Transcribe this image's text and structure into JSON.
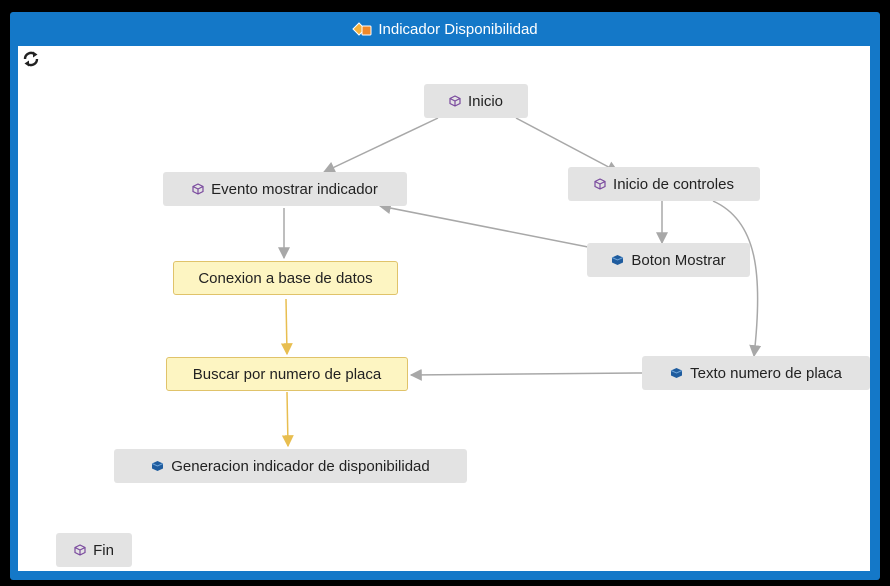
{
  "window": {
    "title": "Indicador Disponibilidad",
    "title_icon": "workflow-icon",
    "accent_color": "#1478c8"
  },
  "toolbar": {
    "refresh_icon": "refresh-icon"
  },
  "colors": {
    "node_gray": "#e3e3e3",
    "node_yellow": "#fdf5c2",
    "node_yellow_border": "#e0c36a",
    "edge_gray": "#a8a8a8",
    "edge_yellow": "#e8be50",
    "icon_purple": "#7a4a9e",
    "icon_blue": "#1f5c9e"
  },
  "nodes": {
    "inicio": {
      "label": "Inicio",
      "icon": "cube-outline-icon"
    },
    "evento": {
      "label": "Evento mostrar indicador",
      "icon": "cube-outline-icon"
    },
    "inicio_controles": {
      "label": "Inicio de controles",
      "icon": "cube-outline-icon"
    },
    "boton_mostrar": {
      "label": "Boton Mostrar",
      "icon": "cube-solid-icon"
    },
    "conexion": {
      "label": "Conexion a base de datos"
    },
    "buscar": {
      "label": "Buscar por numero de placa"
    },
    "texto_placa": {
      "label": "Texto numero de placa",
      "icon": "cube-solid-icon"
    },
    "generacion": {
      "label": "Generacion indicador de disponibilidad",
      "icon": "cube-solid-icon"
    },
    "fin": {
      "label": "Fin",
      "icon": "cube-outline-icon"
    }
  },
  "edges": [
    {
      "from": "inicio",
      "to": "evento",
      "color": "gray"
    },
    {
      "from": "inicio",
      "to": "inicio_controles",
      "color": "gray"
    },
    {
      "from": "inicio_controles",
      "to": "boton_mostrar",
      "color": "gray"
    },
    {
      "from": "inicio_controles",
      "to": "texto_placa",
      "color": "gray"
    },
    {
      "from": "boton_mostrar",
      "to": "evento",
      "color": "gray"
    },
    {
      "from": "evento",
      "to": "conexion",
      "color": "gray"
    },
    {
      "from": "conexion",
      "to": "buscar",
      "color": "yellow"
    },
    {
      "from": "texto_placa",
      "to": "buscar",
      "color": "gray"
    },
    {
      "from": "buscar",
      "to": "generacion",
      "color": "yellow"
    }
  ]
}
